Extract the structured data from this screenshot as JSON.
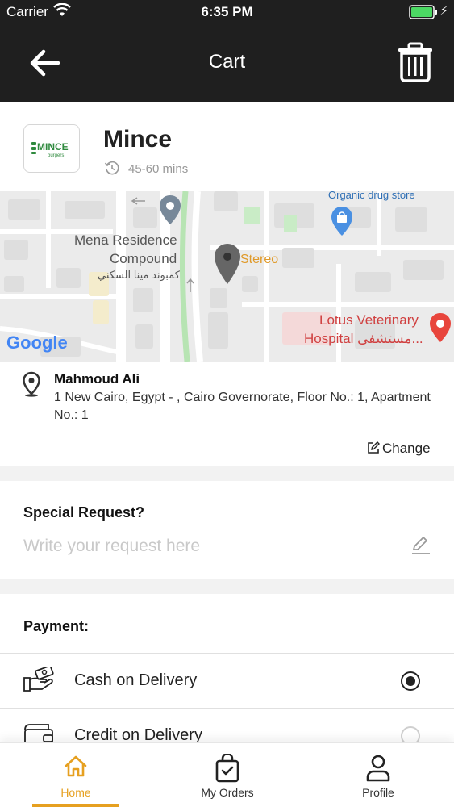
{
  "status_bar": {
    "carrier": "Carrier",
    "time": "6:35 PM"
  },
  "header": {
    "title": "Cart"
  },
  "restaurant": {
    "name": "Mince",
    "logo_text": "MINCE",
    "logo_sub": "burgers",
    "delivery_time": "45-60 mins"
  },
  "map": {
    "labels": {
      "organic": "Organic drug store",
      "mena1": "Mena Residence",
      "mena2": "Compound",
      "mena_ar": "كمبوند مينا السكني",
      "stereo": "Stereo",
      "lotus1": "Lotus Veterinary",
      "lotus2": "Hospital مستشفى...",
      "google": "Google"
    }
  },
  "address": {
    "name": "Mahmoud Ali",
    "line": "1 New Cairo, Egypt - , Cairo Governorate, Floor No.: 1, Apartment No.: 1",
    "change_label": "Change"
  },
  "special_request": {
    "title": "Special Request?",
    "placeholder": "Write your request here"
  },
  "payment": {
    "title": "Payment:",
    "options": [
      {
        "label": "Cash on Delivery",
        "selected": true
      },
      {
        "label": "Credit on Delivery",
        "selected": false
      }
    ]
  },
  "tabs": [
    {
      "label": "Home",
      "active": true
    },
    {
      "label": "My Orders",
      "active": false
    },
    {
      "label": "Profile",
      "active": false
    }
  ],
  "colors": {
    "accent": "#e6a020",
    "header_bg": "#1f1f1f",
    "battery": "#4cd964",
    "map_pin_red": "#e8453c"
  }
}
